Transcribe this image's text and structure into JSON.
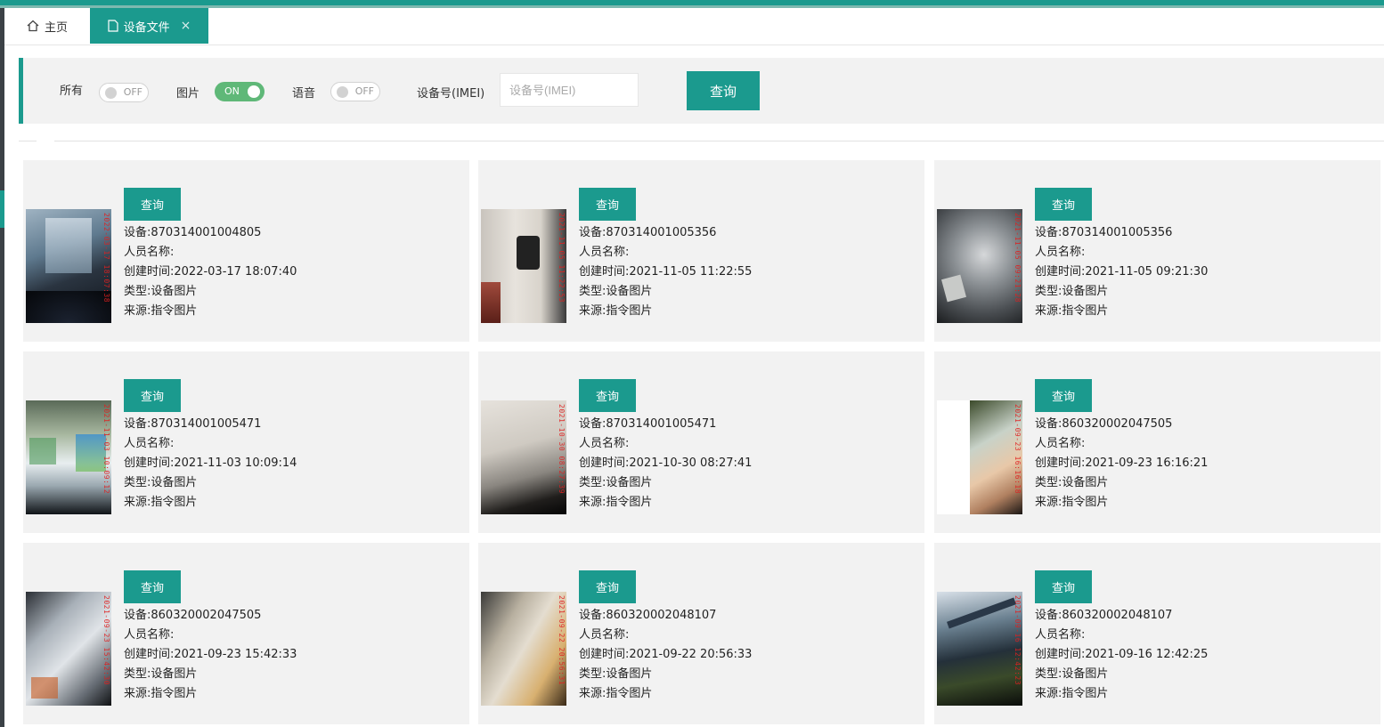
{
  "tabs": {
    "home": "主页",
    "active": "设备文件",
    "close": "×"
  },
  "filters": {
    "all": {
      "label": "所有",
      "state": "OFF"
    },
    "image": {
      "label": "图片",
      "state": "ON"
    },
    "voice": {
      "label": "语音",
      "state": "OFF"
    },
    "imei_label": "设备号(IMEI)",
    "imei_value": "",
    "imei_placeholder": "设备号(IMEI)",
    "query": "查询"
  },
  "cards": [
    {
      "button": "查询",
      "device": "设备:870314001004805",
      "person": "人员名称:",
      "created": "创建时间:2022-03-17 18:07:40",
      "type": "类型:设备图片",
      "source": "来源:指令图片",
      "stamp": "2022-03-17 18:07:38"
    },
    {
      "button": "查询",
      "device": "设备:870314001005356",
      "person": "人员名称:",
      "created": "创建时间:2021-11-05 11:22:55",
      "type": "类型:设备图片",
      "source": "来源:指令图片",
      "stamp": "2021-11-05 11:22:53"
    },
    {
      "button": "查询",
      "device": "设备:870314001005356",
      "person": "人员名称:",
      "created": "创建时间:2021-11-05 09:21:30",
      "type": "类型:设备图片",
      "source": "来源:指令图片",
      "stamp": "2021-11-05 09:21:28"
    },
    {
      "button": "查询",
      "device": "设备:870314001005471",
      "person": "人员名称:",
      "created": "创建时间:2021-11-03 10:09:14",
      "type": "类型:设备图片",
      "source": "来源:指令图片",
      "stamp": "2021-11-03 10:09:12"
    },
    {
      "button": "查询",
      "device": "设备:870314001005471",
      "person": "人员名称:",
      "created": "创建时间:2021-10-30 08:27:41",
      "type": "类型:设备图片",
      "source": "来源:指令图片",
      "stamp": "2021-10-30 08:27:39"
    },
    {
      "button": "查询",
      "device": "设备:860320002047505",
      "person": "人员名称:",
      "created": "创建时间:2021-09-23 16:16:21",
      "type": "类型:设备图片",
      "source": "来源:指令图片",
      "stamp": "2021-09-23 16:16:18"
    },
    {
      "button": "查询",
      "device": "设备:860320002047505",
      "person": "人员名称:",
      "created": "创建时间:2021-09-23 15:42:33",
      "type": "类型:设备图片",
      "source": "来源:指令图片",
      "stamp": "2021-09-23 15:42:30"
    },
    {
      "button": "查询",
      "device": "设备:860320002048107",
      "person": "人员名称:",
      "created": "创建时间:2021-09-22 20:56:33",
      "type": "类型:设备图片",
      "source": "来源:指令图片",
      "stamp": "2021-09-22 20:56:31"
    },
    {
      "button": "查询",
      "device": "设备:860320002048107",
      "person": "人员名称:",
      "created": "创建时间:2021-09-16 12:42:25",
      "type": "类型:设备图片",
      "source": "来源:指令图片",
      "stamp": "2021-09-16 12:42:23"
    }
  ],
  "colors": {
    "accent": "#1b9a8e",
    "switch_on": "#5fb878"
  }
}
